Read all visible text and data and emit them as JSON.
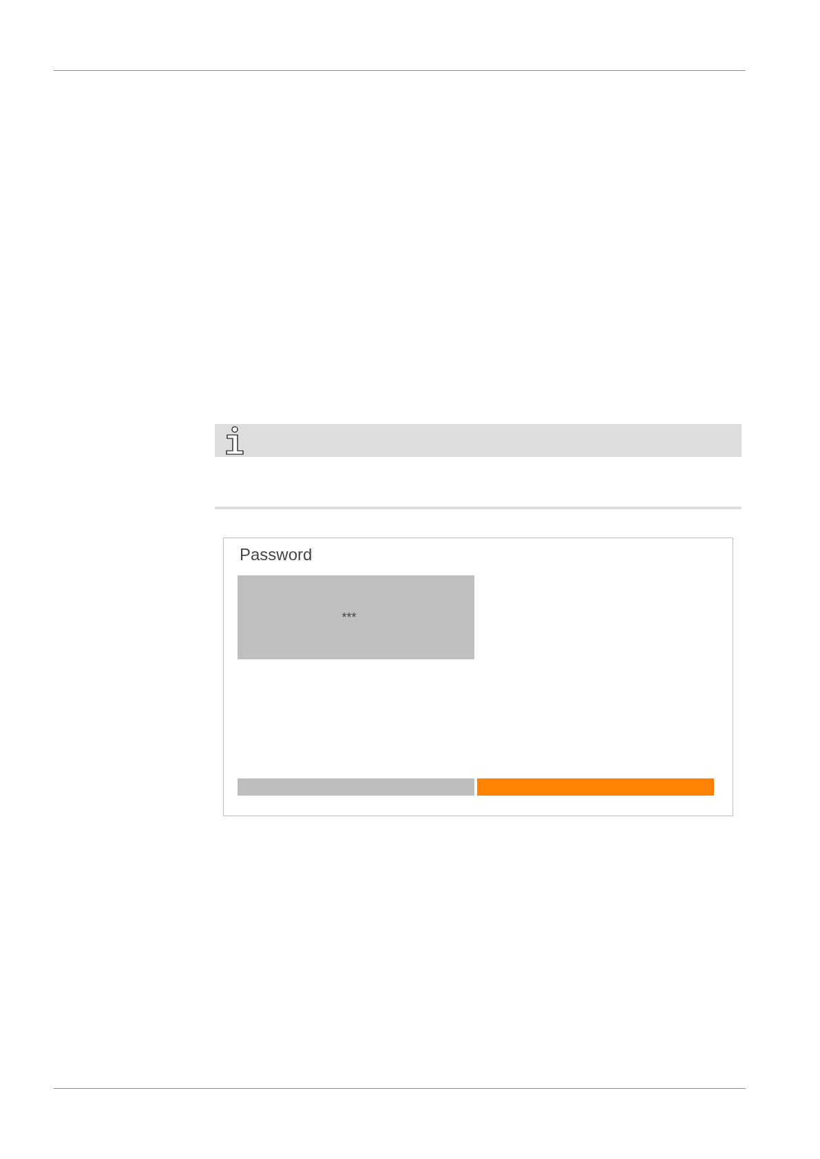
{
  "info_note": {
    "kind": "info"
  },
  "dialog": {
    "title": "Password",
    "password_field": {
      "value": "***"
    },
    "buttons": [
      {
        "color": "#bebebe"
      },
      {
        "color": "#ff8200"
      }
    ]
  }
}
